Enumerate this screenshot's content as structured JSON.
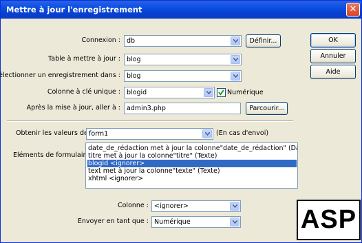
{
  "window": {
    "title": "Mettre à jour l'enregistrement",
    "close": "✕"
  },
  "form": {
    "connection": {
      "label": "Connexion :",
      "value": "db",
      "define_button": "Définir..."
    },
    "table": {
      "label": "Table à mettre à jour :",
      "value": "blog"
    },
    "record": {
      "label": "Sélectionner un enregistrement dans :",
      "value": "blog"
    },
    "key": {
      "label": "Colonne à clé unique :",
      "value": "blogid",
      "numeric_label": "Numérique",
      "numeric_checked": true
    },
    "redirect": {
      "label": "Après la mise à jour, aller à :",
      "value": "admin3.php",
      "browse_button": "Parcourir..."
    },
    "source": {
      "label": "Obtenir les valeurs de :",
      "value": "form1",
      "hint": "(En cas d'envoi)"
    },
    "elements": {
      "label": "Eléments de formulaire :",
      "items": [
        "date_de_rédaction met à jour la colonne\"date_de_rédaction\" (Date)",
        "titre met à jour la colonne\"titre\" (Texte)",
        "blogid <ignorer>",
        "text met à jour la colonne\"texte\" (Texte)",
        "xhtml <ignorer>"
      ],
      "selected_index": 2
    },
    "column": {
      "label": "Colonne :",
      "value": "<ignorer>"
    },
    "send_as": {
      "label": "Envoyer en tant que :",
      "value": "Numérique"
    }
  },
  "buttons": {
    "ok": "OK",
    "cancel": "Annuler",
    "help": "Aide"
  },
  "badge": "ASP"
}
